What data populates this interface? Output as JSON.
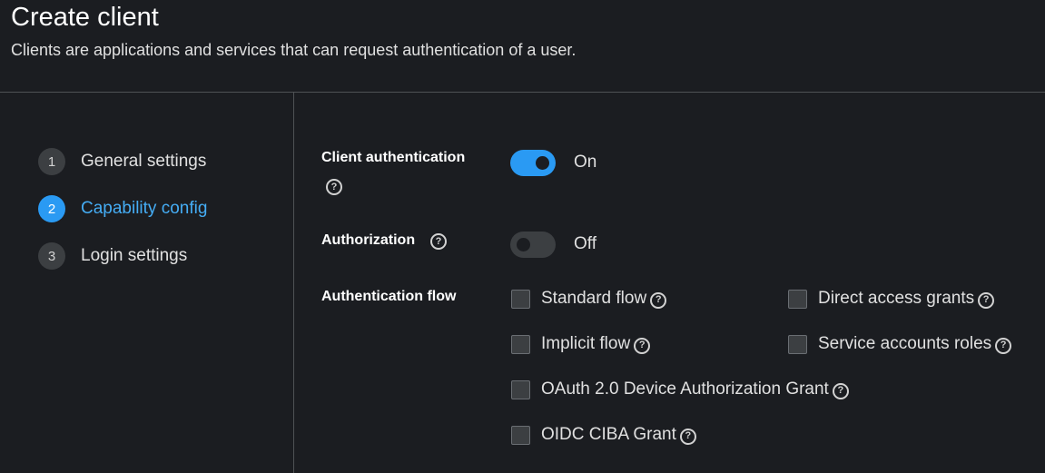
{
  "header": {
    "title": "Create client",
    "subtitle": "Clients are applications and services that can request authentication of a user."
  },
  "wizard": {
    "steps": [
      {
        "number": "1",
        "label": "General settings",
        "current": false
      },
      {
        "number": "2",
        "label": "Capability config",
        "current": true
      },
      {
        "number": "3",
        "label": "Login settings",
        "current": false
      }
    ]
  },
  "form": {
    "client_authentication": {
      "label": "Client authentication",
      "enabled": true,
      "state_text": "On"
    },
    "authorization": {
      "label": "Authorization",
      "enabled": false,
      "state_text": "Off"
    },
    "authentication_flow": {
      "label": "Authentication flow",
      "options": [
        {
          "label": "Standard flow",
          "checked": false
        },
        {
          "label": "Direct access grants",
          "checked": false
        },
        {
          "label": "Implicit flow",
          "checked": false
        },
        {
          "label": "Service accounts roles",
          "checked": false
        },
        {
          "label": "OAuth 2.0 Device Authorization Grant",
          "checked": false
        },
        {
          "label": "OIDC CIBA Grant",
          "checked": false
        }
      ]
    }
  },
  "icons": {
    "help": "help-circle-icon",
    "help_glyph": "?"
  },
  "colors": {
    "background": "#1b1d21",
    "accent": "#2a9af3",
    "accent_text": "#45adf5",
    "divider": "#4f5255"
  }
}
